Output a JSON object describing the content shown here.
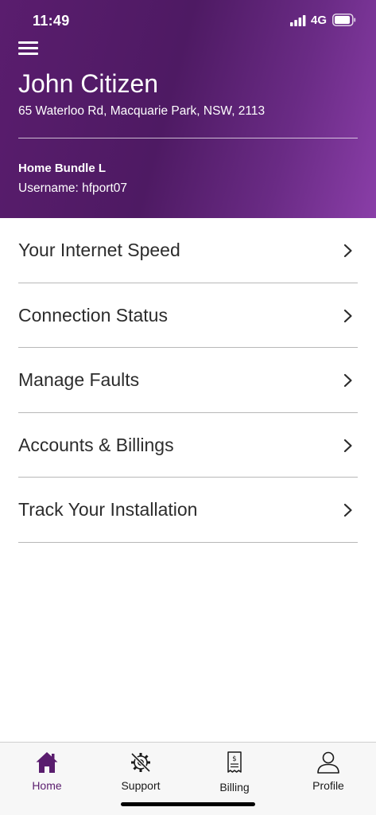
{
  "status": {
    "time": "11:49",
    "network": "4G"
  },
  "header": {
    "name": "John Citizen",
    "address": "65 Waterloo Rd, Macquarie Park, NSW, 2113",
    "plan": "Home Bundle L",
    "username": "Username: hfport07"
  },
  "menu": {
    "items": [
      {
        "label": "Your Internet Speed"
      },
      {
        "label": "Connection Status"
      },
      {
        "label": "Manage Faults"
      },
      {
        "label": "Accounts & Billings"
      },
      {
        "label": "Track Your Installation"
      }
    ]
  },
  "tabs": {
    "items": [
      {
        "label": "Home",
        "icon": "home-icon",
        "active": true
      },
      {
        "label": "Support",
        "icon": "gear-wrench-icon",
        "active": false
      },
      {
        "label": "Billing",
        "icon": "receipt-icon",
        "active": false
      },
      {
        "label": "Profile",
        "icon": "person-icon",
        "active": false
      }
    ]
  },
  "colors": {
    "brand": "#5a1d6e",
    "brand_light": "#8a3ea8"
  }
}
